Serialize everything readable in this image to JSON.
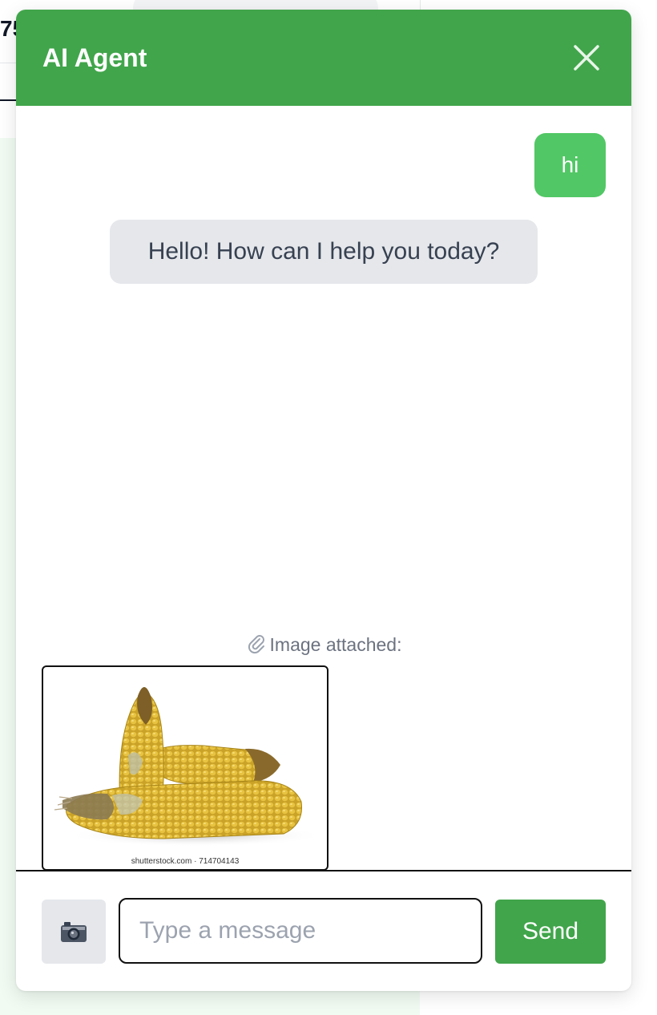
{
  "background": {
    "partial_number": "75"
  },
  "chat": {
    "title": "AI Agent",
    "close_icon": "close-icon",
    "messages": [
      {
        "role": "user",
        "text": "hi"
      },
      {
        "role": "assistant",
        "text": "Hello! How can I help you today?"
      }
    ],
    "attachment": {
      "label": "Image attached:",
      "icon": "paperclip-icon",
      "image_caption": "shutterstock.com · 714704143",
      "image_subject": "dried corn cobs"
    },
    "input": {
      "placeholder": "Type a message",
      "value": ""
    },
    "camera_icon": "camera-icon",
    "send_label": "Send"
  },
  "colors": {
    "header": "#41a54b",
    "user_bubble": "#52c765",
    "bot_bubble": "#e5e7eb",
    "send_button": "#41a54b"
  }
}
